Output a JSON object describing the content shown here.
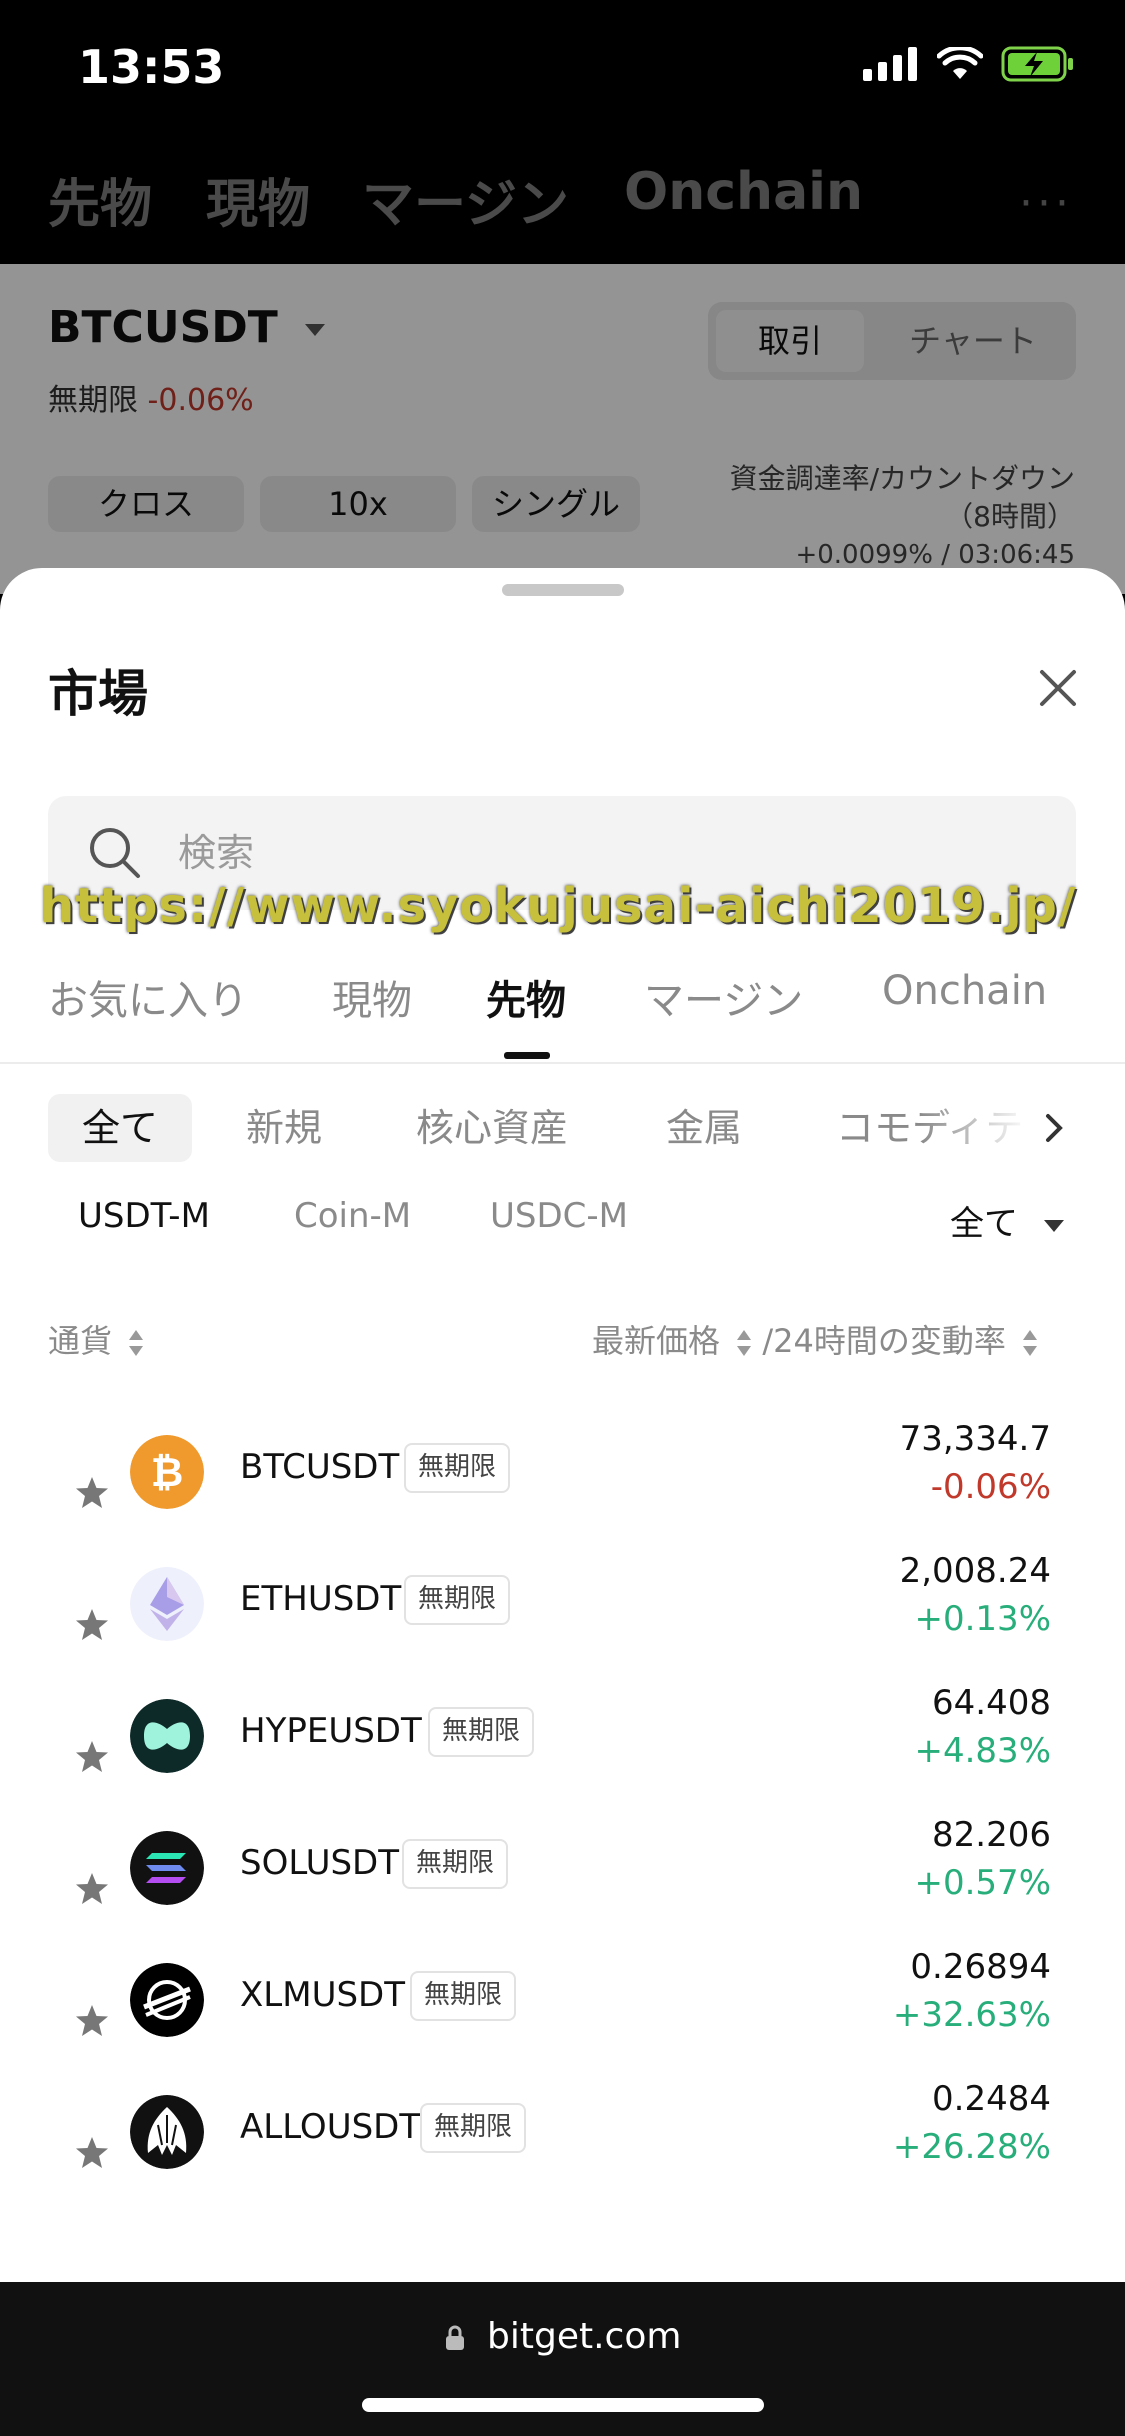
{
  "status": {
    "time": "13:53"
  },
  "topnav": {
    "tabs": [
      "先物",
      "現物",
      "マージン",
      "Onchain"
    ],
    "more": "···"
  },
  "background": {
    "pair": "BTCUSDT",
    "contract_type": "無期限",
    "change": "-0.06%",
    "segment": {
      "trade": "取引",
      "chart": "チャート"
    },
    "pills": [
      "クロス",
      "10x",
      "シングル"
    ],
    "funding_label": "資金調達率/カウントダウン",
    "funding_period": "（8時間）",
    "funding_value": "+0.0099% / 03:06:45"
  },
  "sheet": {
    "title": "市場",
    "search_placeholder": "検索",
    "watermark": "https://www.syokujusai-aichi2019.jp/",
    "market_tabs": [
      "お気に入り",
      "現物",
      "先物",
      "マージン",
      "Onchain"
    ],
    "categories": [
      "全て",
      "新規",
      "核心資産",
      "金属",
      "コモディテ"
    ],
    "sub_tabs": [
      "USDT-M",
      "Coin-M",
      "USDC-M"
    ],
    "filter": "全て",
    "header_currency": "通貨",
    "header_price": "最新価格",
    "header_change": "/24時間の変動率",
    "rows": [
      {
        "symbol": "BTCUSDT",
        "tag": "無期限",
        "price": "73,334.7",
        "change": "-0.06%"
      },
      {
        "symbol": "ETHUSDT",
        "tag": "無期限",
        "price": "2,008.24",
        "change": "+0.13%"
      },
      {
        "symbol": "HYPEUSDT",
        "tag": "無期限",
        "price": "64.408",
        "change": "+4.83%"
      },
      {
        "symbol": "SOLUSDT",
        "tag": "無期限",
        "price": "82.206",
        "change": "+0.57%"
      },
      {
        "symbol": "XLMUSDT",
        "tag": "無期限",
        "price": "0.26894",
        "change": "+32.63%"
      },
      {
        "symbol": "ALLOUSDT",
        "tag": "無期限",
        "price": "0.2484",
        "change": "+26.28%"
      }
    ]
  },
  "browser": {
    "url": "bitget.com"
  },
  "colors": {
    "positive": "#27ae7a",
    "negative": "#c0392b",
    "bitcoin": "#f09a2e"
  }
}
